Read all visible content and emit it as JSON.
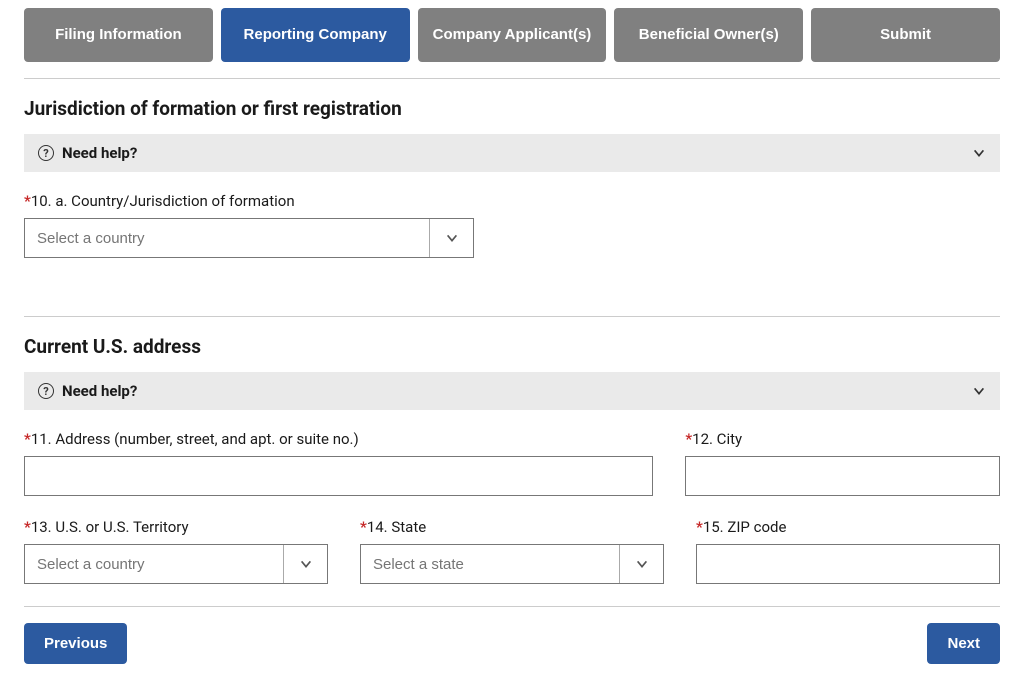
{
  "tabs": {
    "filing_info": "Filing Information",
    "reporting_company": "Reporting Company",
    "company_applicant": "Company Applicant(s)",
    "beneficial_owners": "Beneficial Owner(s)",
    "submit": "Submit"
  },
  "sections": {
    "jurisdiction": {
      "title": "Jurisdiction of formation or first registration",
      "help_label": "Need help?",
      "fields": {
        "country": {
          "label": "10. a. Country/Jurisdiction of formation",
          "placeholder": "Select a country"
        }
      }
    },
    "address": {
      "title": "Current U.S. address",
      "help_label": "Need help?",
      "fields": {
        "street": {
          "label": "11. Address (number, street, and apt. or suite no.)"
        },
        "city": {
          "label": "12. City"
        },
        "territory": {
          "label": "13. U.S. or U.S. Territory",
          "placeholder": "Select a country"
        },
        "state": {
          "label": "14. State",
          "placeholder": "Select a state"
        },
        "zip": {
          "label": "15. ZIP code"
        }
      }
    }
  },
  "buttons": {
    "previous": "Previous",
    "next": "Next"
  }
}
